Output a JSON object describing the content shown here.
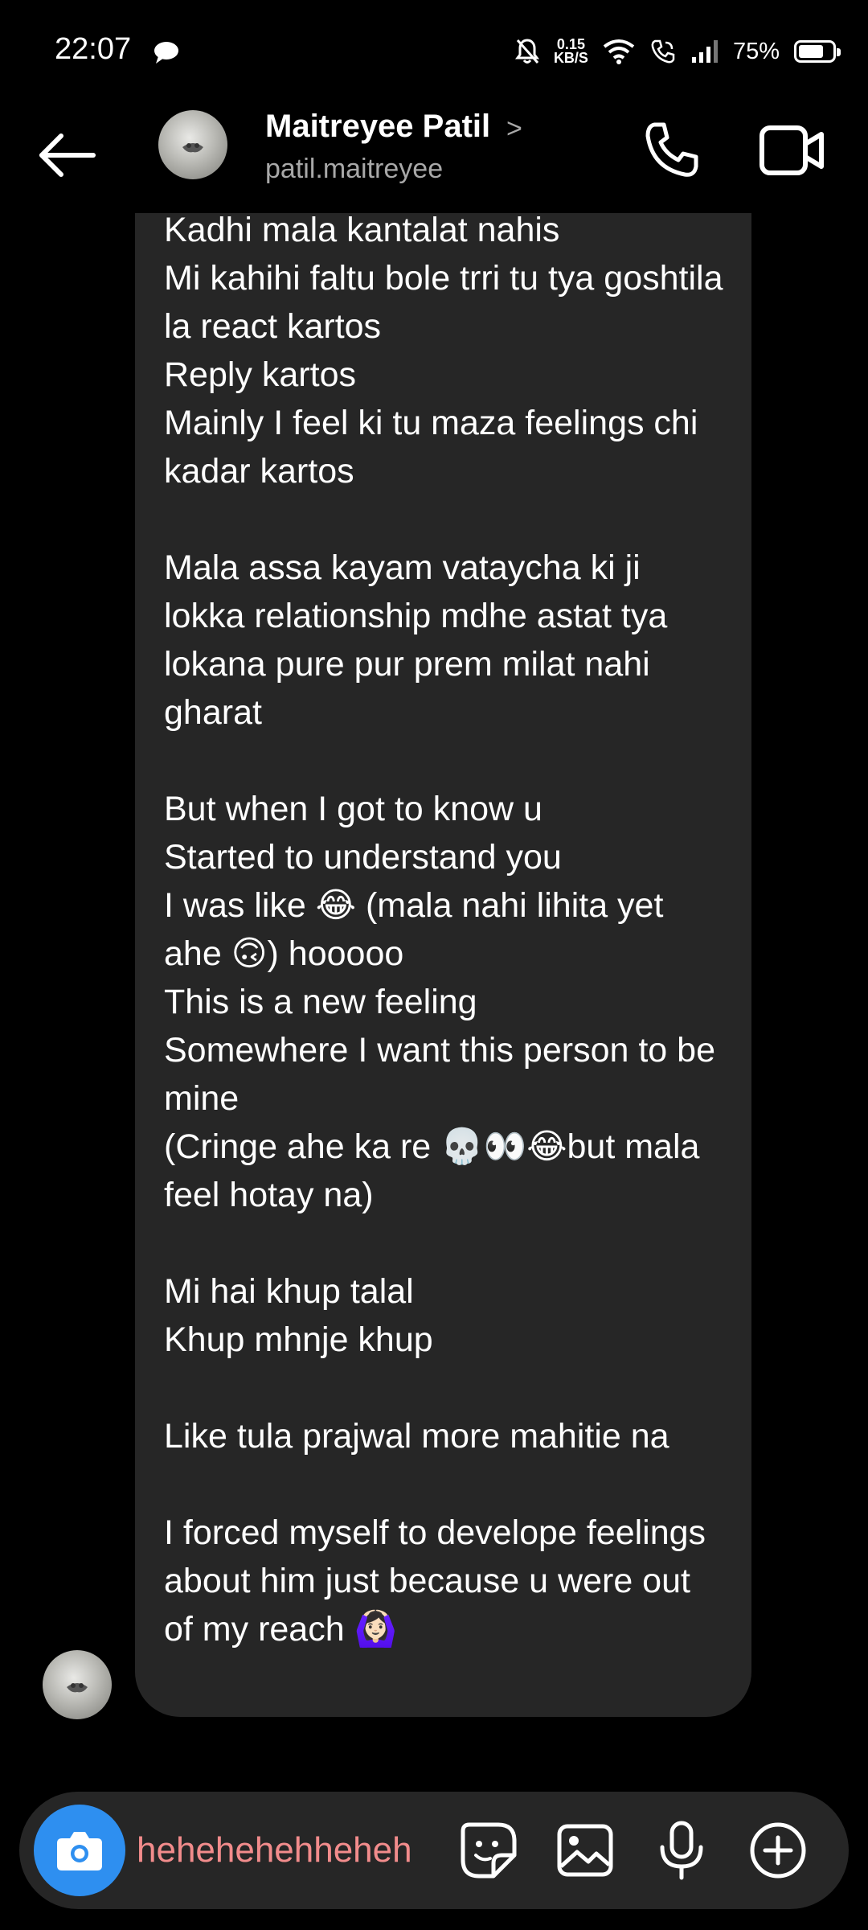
{
  "status_bar": {
    "time": "22:07",
    "net_speed_value": "0.15",
    "net_speed_unit": "KB/S",
    "battery_percent": "75%",
    "battery_level": 0.75
  },
  "header": {
    "contact_name": "Maitreyee Patil",
    "username": "patil.maitreyee",
    "chevron": ">"
  },
  "message": {
    "text": "Kadhi mala kantalat nahis\nMi kahihi faltu bole trri tu tya goshtila la react kartos\nReply kartos\nMainly I feel ki tu maza feelings chi kadar kartos\n\nMala assa kayam vataycha ki ji lokka relationship mdhe astat tya lokana pure pur prem milat nahi gharat\n\nBut when I got to know u\nStarted to understand you\nI was like 😂 (mala nahi lihita yet ahe 🙃) hooooo\nThis is a new feeling\nSomewhere I want this person to be mine\n(Cringe ahe ka re 💀👀😂but mala feel hotay na)\n\nMi hai khup talal\nKhup mhnje khup\n\nLike tula prajwal more mahitie na\n\nI forced myself to develope feelings about him just because u were out of my reach 🙆🏻‍♀️"
  },
  "composer": {
    "input_value": "hehehehehheheh"
  },
  "colors": {
    "background": "#000000",
    "bubble": "#262626",
    "camera_button": "#2e8ff0",
    "input_text": "#f28c8c",
    "secondary_text": "#a8a8a8"
  },
  "icons": {
    "back": "arrow-left-icon",
    "call": "phone-icon",
    "video": "video-camera-icon",
    "camera": "camera-icon",
    "sticker": "sticker-icon",
    "gallery": "image-icon",
    "mic": "microphone-icon",
    "more": "plus-circle-icon"
  }
}
